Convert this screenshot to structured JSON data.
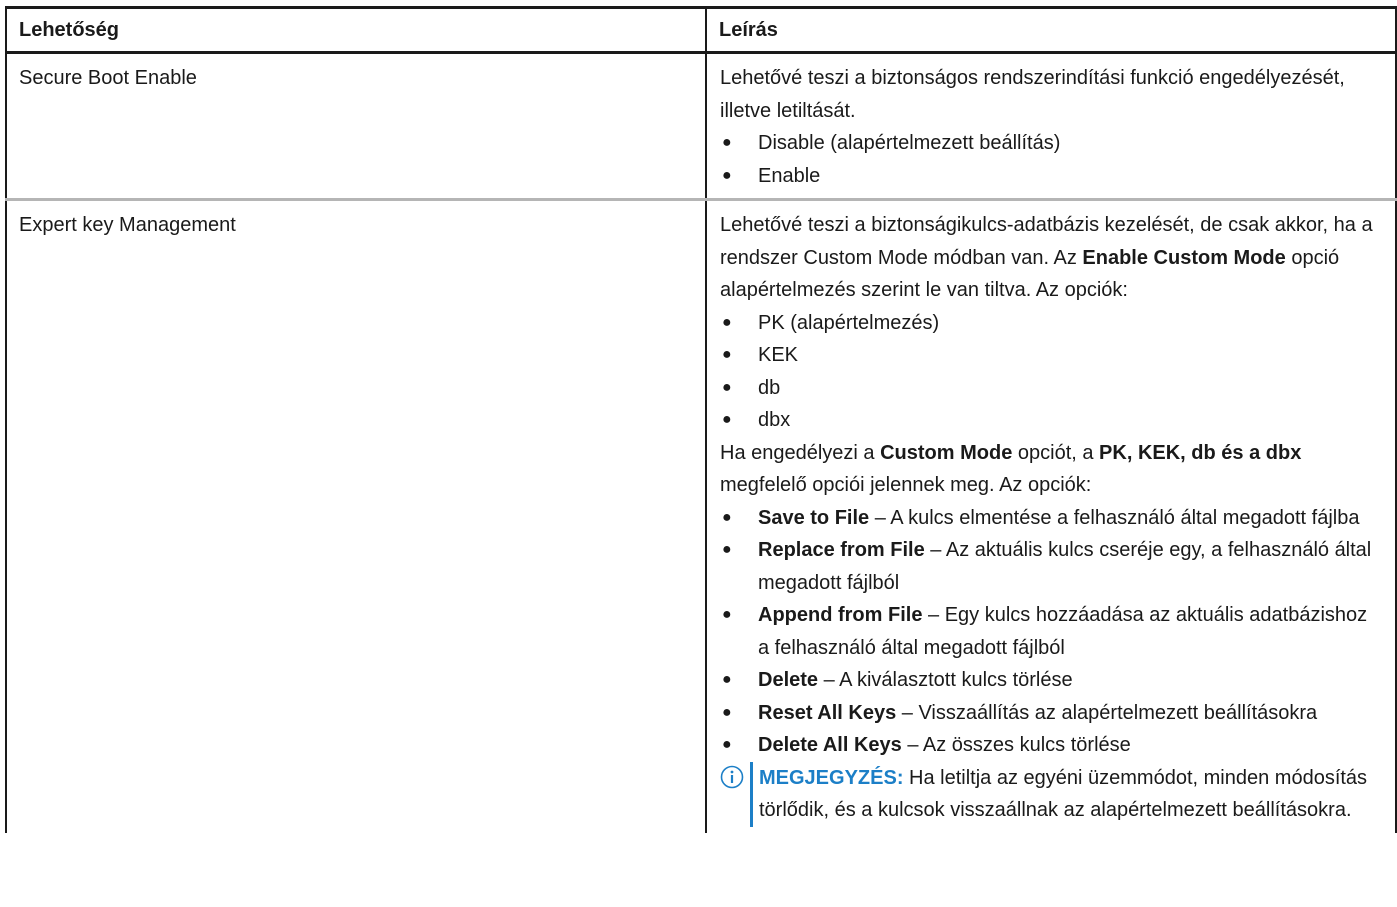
{
  "table": {
    "headers": [
      "Lehetőség",
      "Leírás"
    ],
    "row1": {
      "option": "Secure Boot Enable",
      "desc_intro": "Lehetővé teszi a biztonságos rendszerindítási funkció engedélyezését, illetve letiltását.",
      "bullets": [
        "Disable (alapértelmezett beállítás)",
        "Enable"
      ]
    },
    "row2": {
      "option": "Expert key Management",
      "intro_part1": "Lehetővé teszi a biztonságikulcs-adatbázis kezelését, de csak akkor, ha a rendszer Custom Mode módban van. Az ",
      "intro_bold": "Enable Custom Mode",
      "intro_part2": " opció alapértelmezés szerint le van tiltva. Az opciók:",
      "key_bullets": [
        "PK (alapértelmezés)",
        "KEK",
        "db",
        "dbx"
      ],
      "custom_part1": "Ha engedélyezi a ",
      "custom_bold1": "Custom Mode",
      "custom_part2": " opciót, a ",
      "custom_bold2": "PK, KEK, db és a dbx",
      "custom_part3": " megfelelő opciói jelennek meg. Az opciók:",
      "actions": [
        {
          "name": "Save to File",
          "desc": " – A kulcs elmentése a felhasználó által megadott fájlba"
        },
        {
          "name": "Replace from File",
          "desc": " – Az aktuális kulcs cseréje egy, a felhasználó által megadott fájlból"
        },
        {
          "name": "Append from File",
          "desc": " – Egy kulcs hozzáadása az aktuális adatbázishoz a felhasználó által megadott fájlból"
        },
        {
          "name": "Delete",
          "desc": " – A kiválasztott kulcs törlése"
        },
        {
          "name": "Reset All Keys",
          "desc": " – Visszaállítás az alapértelmezett beállításokra"
        },
        {
          "name": "Delete All Keys",
          "desc": " – Az összes kulcs törlése"
        }
      ],
      "note_label": "MEGJEGYZÉS:",
      "note_text": " Ha letiltja az egyéni üzemmódot, minden módosítás törlődik, és a kulcsok visszaállnak az alapértelmezett beállításokra."
    }
  },
  "bullet_glyph": "●",
  "colors": {
    "note_accent": "#1c7fc7",
    "text": "#1a1a1a",
    "row_divider": "#b5b5b5"
  },
  "icons": {
    "note": "info-circle-icon"
  }
}
